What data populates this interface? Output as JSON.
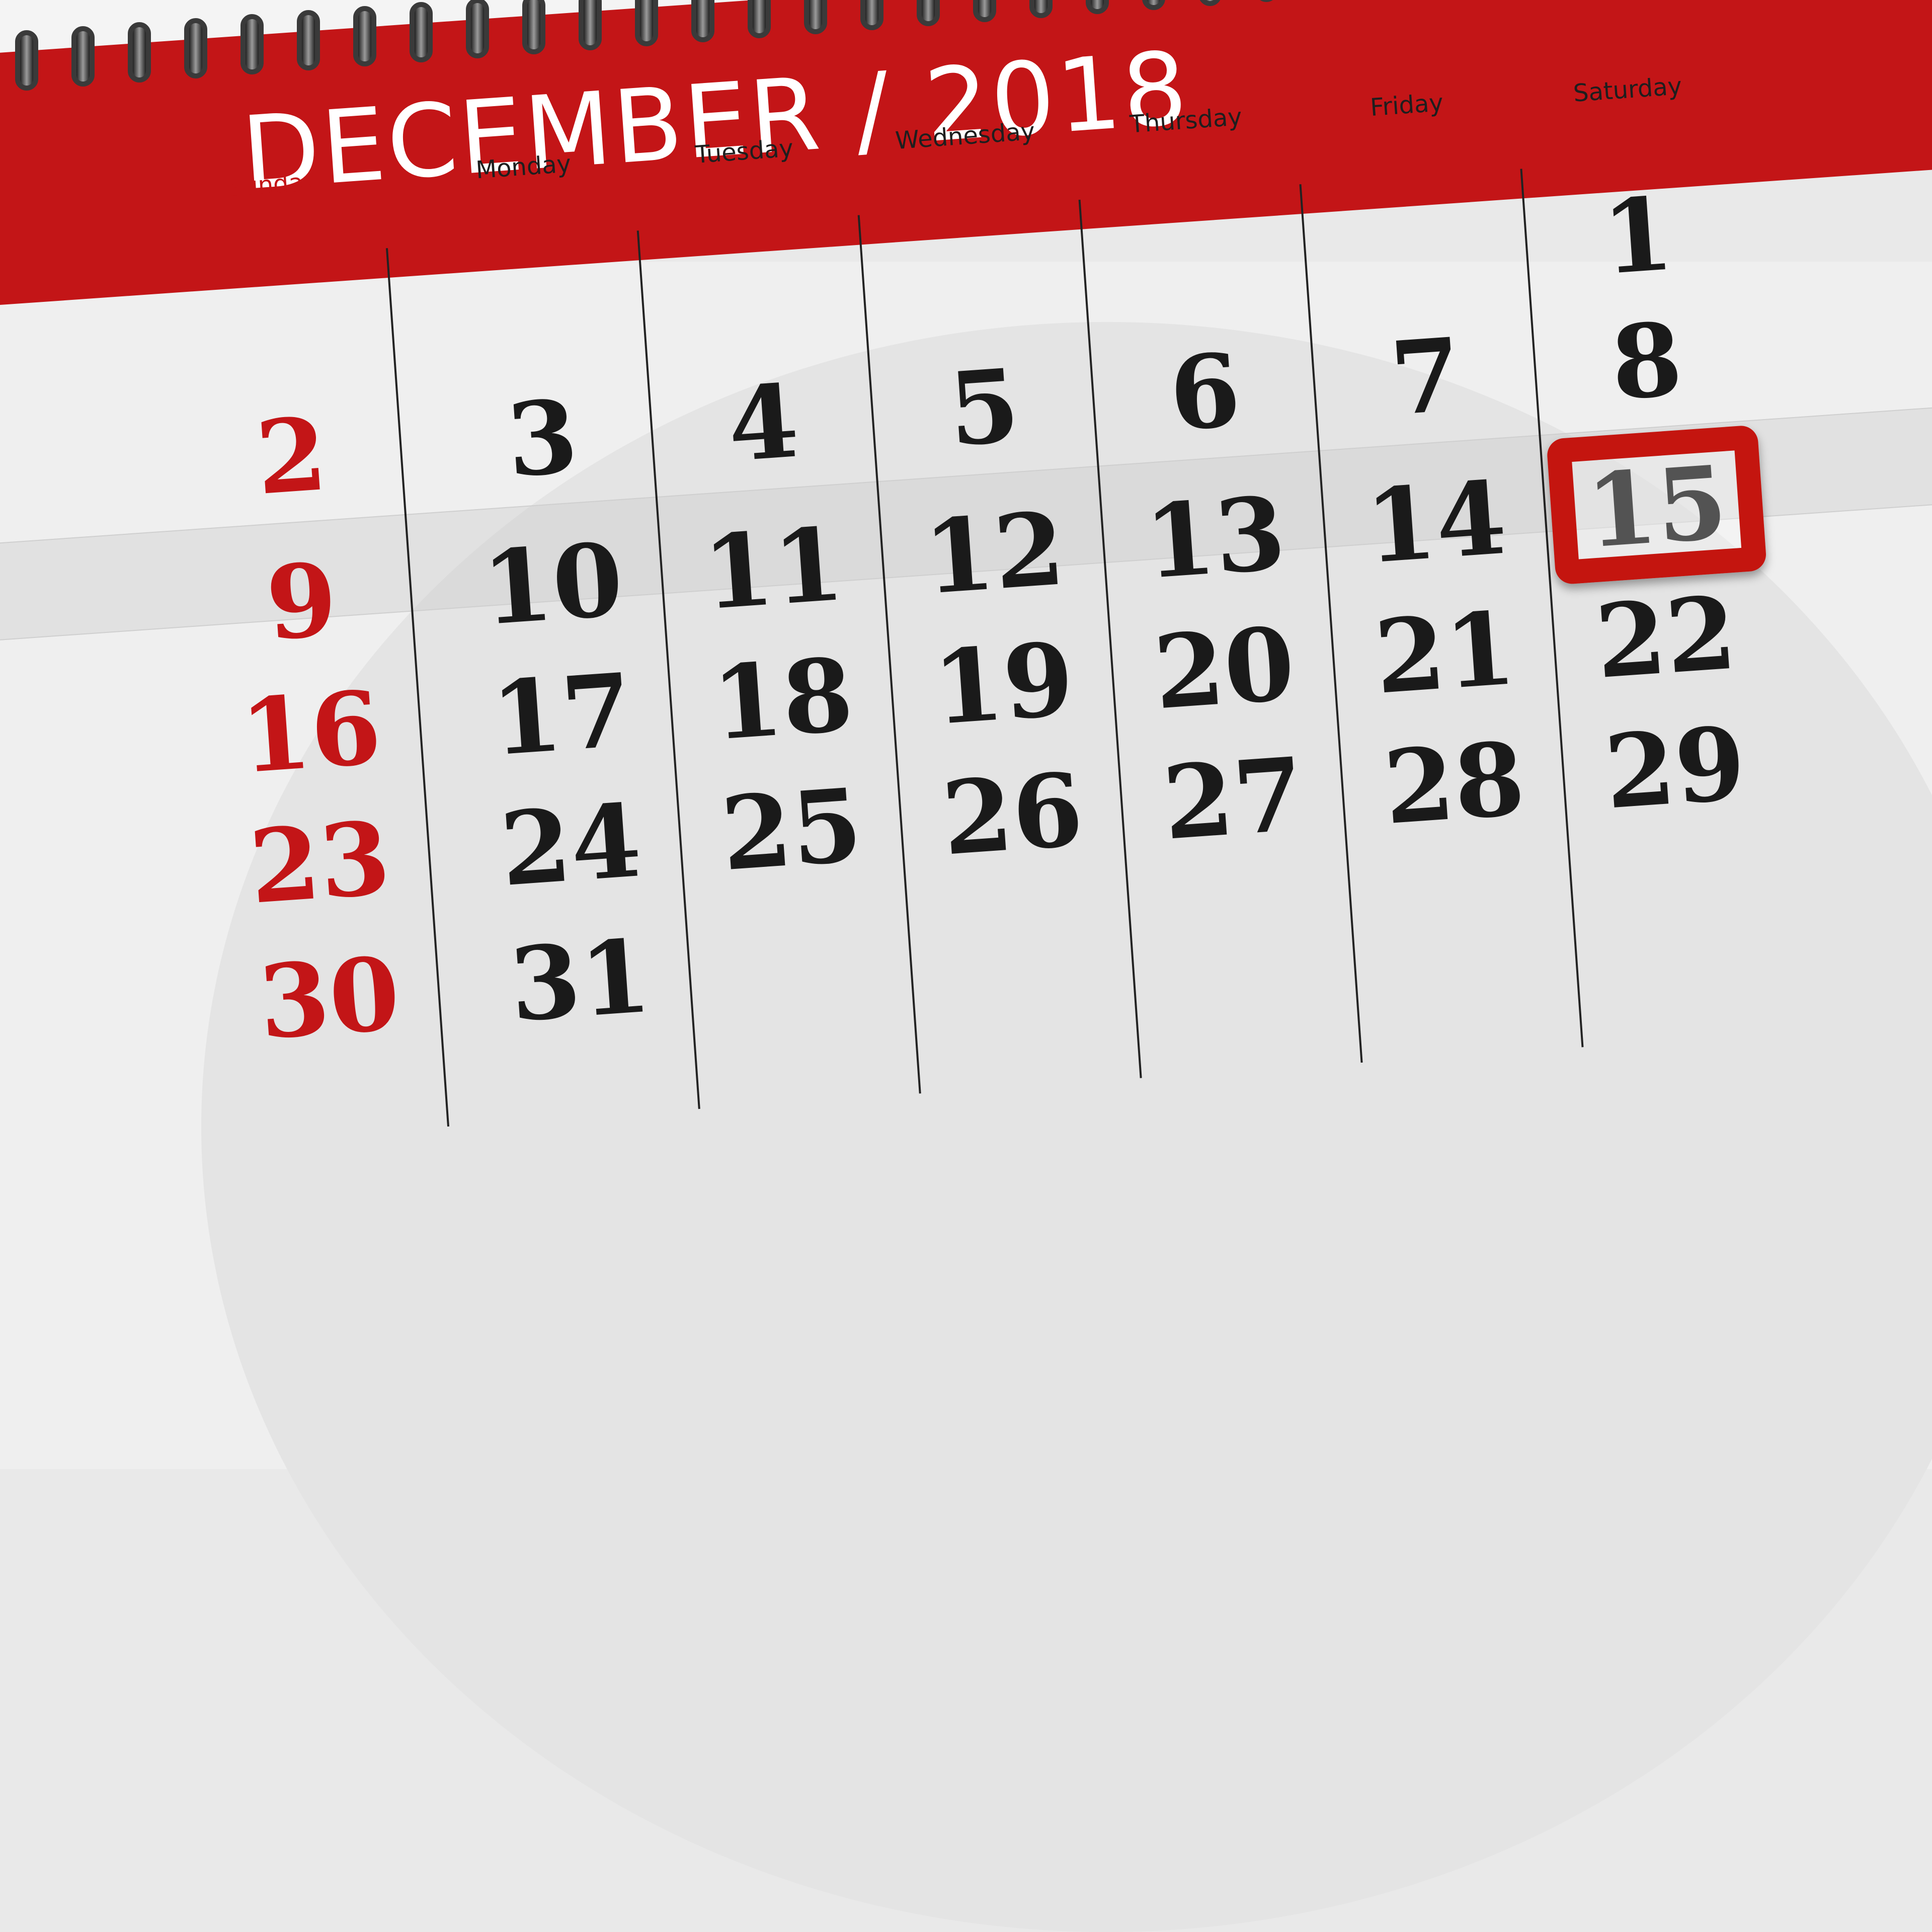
{
  "calendar": {
    "month": "DECEMBER",
    "separator": "/",
    "year": "2018",
    "title": "DECEMBER / 2018",
    "colors": {
      "header": "#c31517",
      "sunday": "#c31517",
      "text": "#1a1a1a",
      "marker": "#c4150f"
    },
    "weekdays": [
      "Sunday",
      "Monday",
      "Tuesday",
      "Wednesday",
      "Thursday",
      "Friday",
      "Saturday"
    ],
    "columns": [
      {
        "day": "Sunday",
        "dates": [
          "",
          "2",
          "9",
          "16",
          "23",
          "30"
        ]
      },
      {
        "day": "Monday",
        "dates": [
          "",
          "3",
          "10",
          "17",
          "24",
          "31"
        ]
      },
      {
        "day": "Tuesday",
        "dates": [
          "",
          "4",
          "11",
          "18",
          "25",
          ""
        ]
      },
      {
        "day": "Wednesday",
        "dates": [
          "",
          "5",
          "12",
          "19",
          "26",
          ""
        ]
      },
      {
        "day": "Thursday",
        "dates": [
          "",
          "6",
          "13",
          "20",
          "27",
          ""
        ]
      },
      {
        "day": "Friday",
        "dates": [
          "",
          "7",
          "14",
          "21",
          "28",
          ""
        ]
      },
      {
        "day": "Saturday",
        "dates": [
          "1",
          "8",
          "15",
          "22",
          "29",
          ""
        ]
      }
    ],
    "highlighted_date": "15",
    "highlighted_week": [
      "9",
      "10",
      "11",
      "12",
      "13",
      "14",
      "15"
    ]
  }
}
